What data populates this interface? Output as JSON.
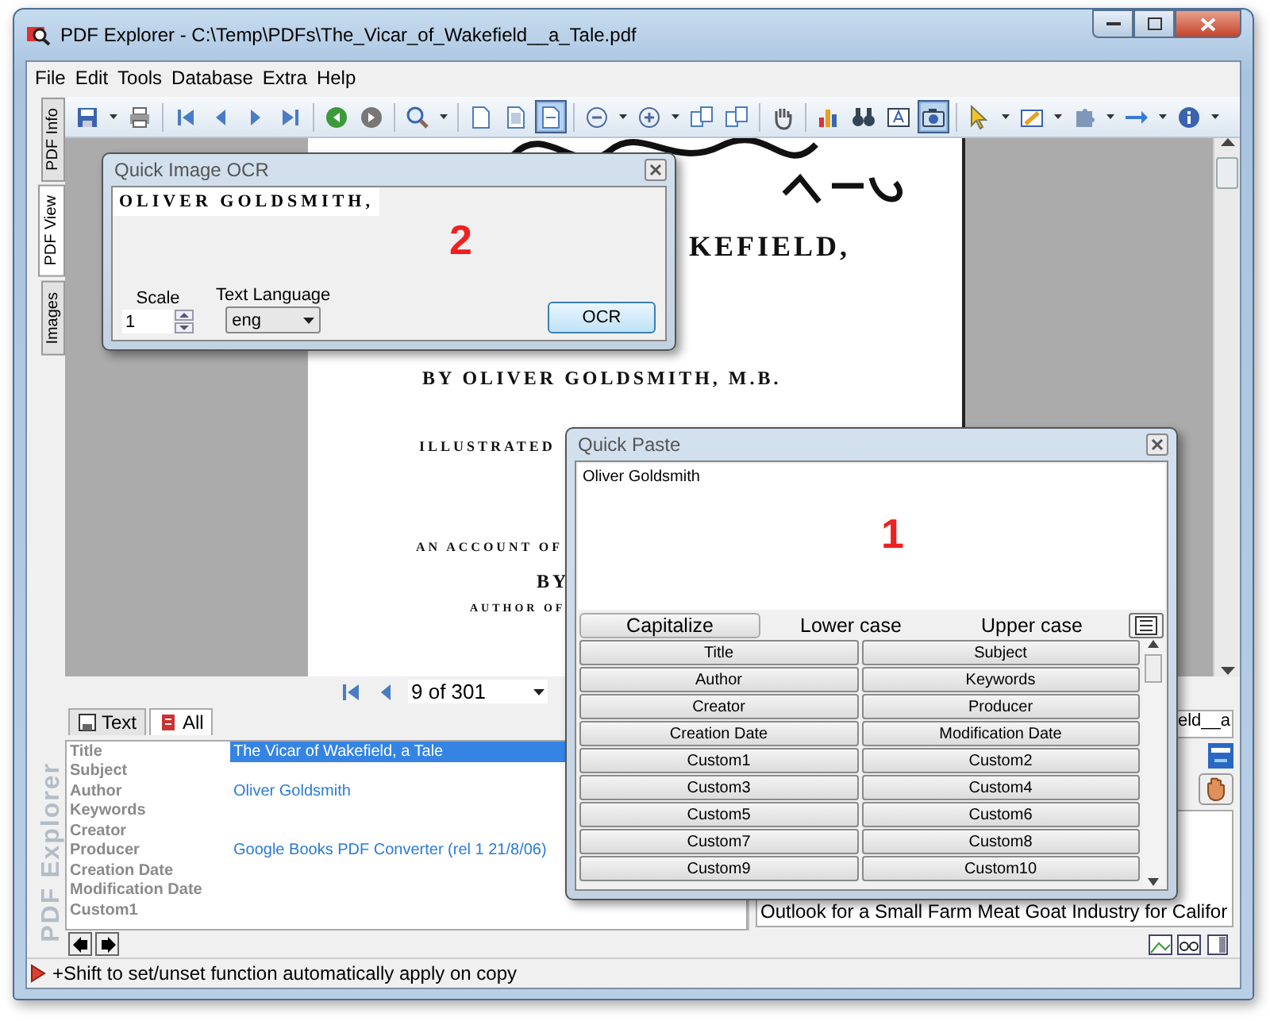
{
  "window": {
    "title": "PDF Explorer - C:\\Temp\\PDFs\\The_Vicar_of_Wakefield__a_Tale.pdf"
  },
  "menu": [
    "File",
    "Edit",
    "Tools",
    "Database",
    "Extra",
    "Help"
  ],
  "toolbar": [
    {
      "kind": "save",
      "selected": false
    },
    {
      "kind": "caret",
      "selected": false
    },
    {
      "kind": "print",
      "selected": false
    },
    {
      "kind": "sep"
    },
    {
      "kind": "first",
      "selected": false
    },
    {
      "kind": "prev",
      "selected": false
    },
    {
      "kind": "next",
      "selected": false
    },
    {
      "kind": "last",
      "selected": false
    },
    {
      "kind": "sep"
    },
    {
      "kind": "back",
      "selected": false
    },
    {
      "kind": "forward",
      "selected": false
    },
    {
      "kind": "sep"
    },
    {
      "kind": "zoom",
      "selected": false
    },
    {
      "kind": "caret",
      "selected": false
    },
    {
      "kind": "sep"
    },
    {
      "kind": "page",
      "selected": false
    },
    {
      "kind": "page-fit",
      "selected": false
    },
    {
      "kind": "page-width",
      "selected": true
    },
    {
      "kind": "sep"
    },
    {
      "kind": "minus",
      "selected": false
    },
    {
      "kind": "caret",
      "selected": false
    },
    {
      "kind": "plus",
      "selected": false
    },
    {
      "kind": "caret",
      "selected": false
    },
    {
      "kind": "rotate",
      "selected": false
    },
    {
      "kind": "rotate",
      "selected": false
    },
    {
      "kind": "sep"
    },
    {
      "kind": "hand",
      "selected": false
    },
    {
      "kind": "sep"
    },
    {
      "kind": "chart",
      "selected": false
    },
    {
      "kind": "binoculars",
      "selected": false
    },
    {
      "kind": "text-select",
      "selected": false
    },
    {
      "kind": "camera",
      "selected": true
    },
    {
      "kind": "sep"
    },
    {
      "kind": "cursor",
      "selected": false
    },
    {
      "kind": "caret",
      "selected": false
    },
    {
      "kind": "highlighter",
      "selected": false
    },
    {
      "kind": "caret",
      "selected": false
    },
    {
      "kind": "puzzle",
      "selected": false
    },
    {
      "kind": "caret",
      "selected": false
    },
    {
      "kind": "arrow",
      "selected": false
    },
    {
      "kind": "caret",
      "selected": false
    },
    {
      "kind": "info",
      "selected": false
    },
    {
      "kind": "caret",
      "selected": false
    }
  ],
  "side_tabs": [
    {
      "label": "PDF Info",
      "selected": false
    },
    {
      "label": "PDF View",
      "selected": true
    },
    {
      "label": "Images",
      "selected": false
    }
  ],
  "side_logo": "PDF Explorer",
  "page": {
    "lines": [
      {
        "kind": "title",
        "text": "KEFIELD,"
      },
      {
        "kind": "byline",
        "text": "BY OLIVER GOLDSMITH, M.B."
      },
      {
        "kind": "illustrated",
        "text": "ILLUSTRATED"
      },
      {
        "kind": "account",
        "text": "AN ACCOUNT OF"
      },
      {
        "kind": "by",
        "text": "BY"
      },
      {
        "kind": "author",
        "text": "AUTHOR OF"
      }
    ]
  },
  "page_nav": {
    "page": "9 of 301"
  },
  "info_tabs": [
    {
      "label": "Text",
      "selected": false
    },
    {
      "label": "All",
      "selected": true
    }
  ],
  "info_rows": [
    {
      "label": "Title",
      "value": "The Vicar of Wakefield, a Tale",
      "selected": true
    },
    {
      "label": "Subject",
      "selected": false
    },
    {
      "label": "Author",
      "value": "Oliver Goldsmith",
      "selected": false
    },
    {
      "label": "Keywords",
      "selected": false
    },
    {
      "label": "Creator",
      "selected": false
    },
    {
      "label": "Producer",
      "value": "Google Books PDF Converter (rel 1 21/8/06)",
      "selected": false
    },
    {
      "label": "Creation Date",
      "selected": false
    },
    {
      "label": "Modification Date",
      "selected": false
    },
    {
      "label": "Custom1",
      "selected": false
    }
  ],
  "right_panel": {
    "file_field": "eld__a",
    "list": [
      "Outlook for a Small Farm Meat Goat Industry for Califor"
    ]
  },
  "status_bar": "+Shift to set/unset function automatically apply on copy",
  "ocr_dialog": {
    "title": "Quick Image OCR",
    "image_text": "OLIVER GOLDSMITH,",
    "annotation": "2",
    "scale_label": "Scale",
    "scale": "1",
    "language_label": "Text Language",
    "language": "eng",
    "button": "OCR"
  },
  "paste_dialog": {
    "title": "Quick Paste",
    "text": "Oliver Goldsmith",
    "annotation": "1",
    "case_buttons": [
      {
        "label": "Capitalize",
        "selected": true
      },
      {
        "label": "Lower case",
        "selected": false
      },
      {
        "label": "Upper case",
        "selected": false
      }
    ],
    "fields": [
      "Title",
      "Subject",
      "Author",
      "Keywords",
      "Creator",
      "Producer",
      "Creation Date",
      "Modification Date",
      "Custom1",
      "Custom2",
      "Custom3",
      "Custom4",
      "Custom5",
      "Custom6",
      "Custom7",
      "Custom8",
      "Custom9",
      "Custom10"
    ]
  }
}
